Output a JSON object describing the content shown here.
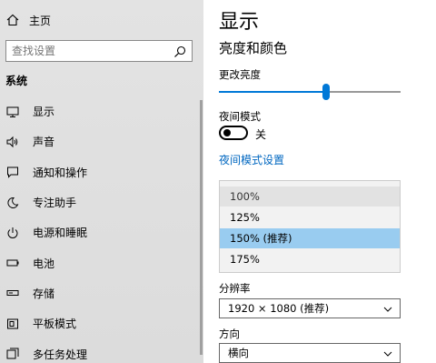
{
  "sidebar": {
    "home_label": "主页",
    "search_placeholder": "查找设置",
    "section_title": "系统",
    "items": [
      {
        "label": "显示",
        "icon": "monitor-icon"
      },
      {
        "label": "声音",
        "icon": "speaker-icon"
      },
      {
        "label": "通知和操作",
        "icon": "message-icon"
      },
      {
        "label": "专注助手",
        "icon": "moon-icon"
      },
      {
        "label": "电源和睡眠",
        "icon": "power-icon"
      },
      {
        "label": "电池",
        "icon": "battery-icon"
      },
      {
        "label": "存储",
        "icon": "storage-icon"
      },
      {
        "label": "平板模式",
        "icon": "tablet-icon"
      },
      {
        "label": "多任务处理",
        "icon": "multitask-icon"
      }
    ]
  },
  "main": {
    "title": "显示",
    "subtitle": "亮度和颜色",
    "brightness_label": "更改亮度",
    "brightness_level": 0.59,
    "night_mode_label": "夜间模式",
    "night_mode_state": "关",
    "night_mode_link": "夜间模式设置",
    "scale_options": [
      "100%",
      "125%",
      "150% (推荐)",
      "175%"
    ],
    "scale_selected_index": 2,
    "resolution_label": "分辨率",
    "resolution_value": "1920 × 1080 (推荐)",
    "orientation_label": "方向",
    "orientation_value": "横向"
  },
  "colors": {
    "accent": "#0078d7",
    "link": "#0067c0",
    "selected_option": "#99ccf0",
    "sidebar_bg": "#e0e0e0"
  }
}
